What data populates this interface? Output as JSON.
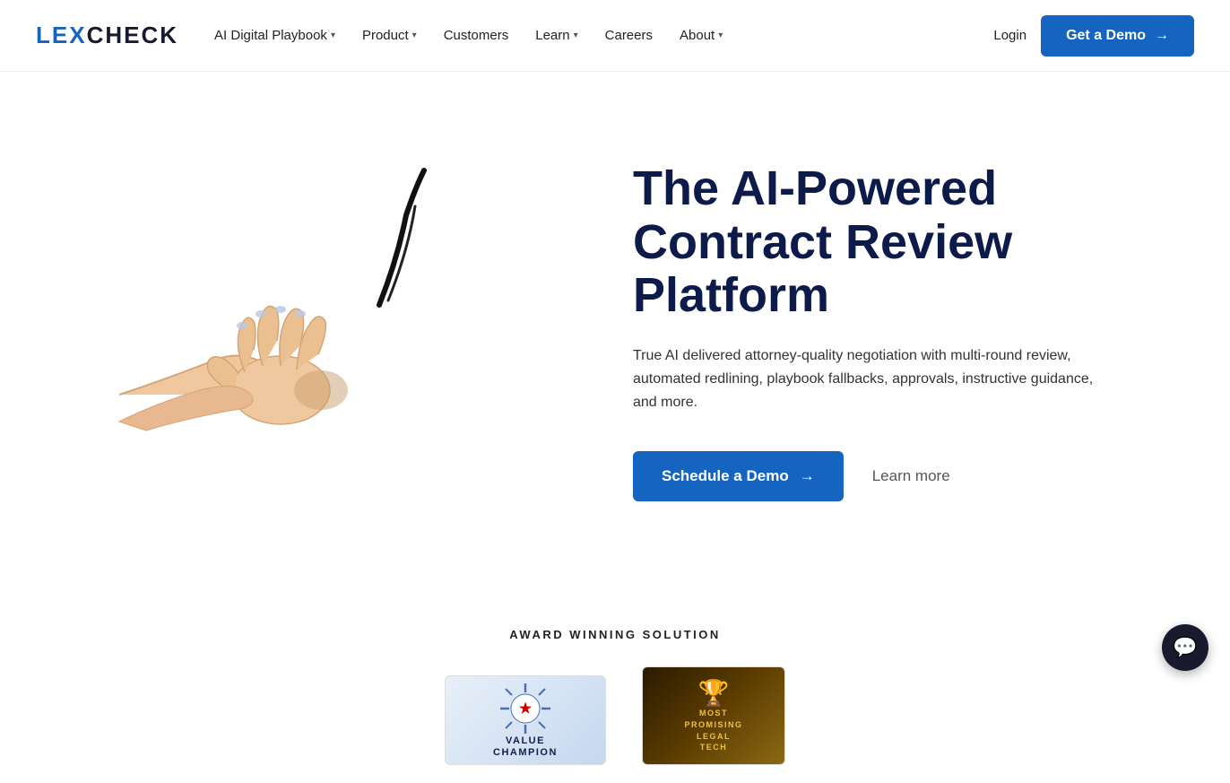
{
  "brand": {
    "name_lex": "LEX",
    "name_check": "CHECK",
    "logo_label": "LexCheck logo"
  },
  "nav": {
    "links": [
      {
        "id": "ai-digital-playbook",
        "label": "AI Digital Playbook",
        "has_dropdown": true
      },
      {
        "id": "product",
        "label": "Product",
        "has_dropdown": true
      },
      {
        "id": "customers",
        "label": "Customers",
        "has_dropdown": false
      },
      {
        "id": "learn",
        "label": "Learn",
        "has_dropdown": true
      },
      {
        "id": "careers",
        "label": "Careers",
        "has_dropdown": false
      },
      {
        "id": "about",
        "label": "About",
        "has_dropdown": true
      }
    ],
    "login_label": "Login",
    "get_demo_label": "Get a Demo",
    "get_demo_arrow": "→"
  },
  "hero": {
    "title": "The AI-Powered Contract Review Platform",
    "subtitle": "True AI delivered attorney-quality negotiation with multi-round review, automated redlining, playbook fallbacks, approvals, instructive guidance, and more.",
    "cta_primary": "Schedule a Demo",
    "cta_primary_arrow": "→",
    "cta_secondary": "Learn more"
  },
  "awards": {
    "section_label": "AWARD WINNING SOLUTION",
    "badges": [
      {
        "id": "value-champion",
        "star": "★",
        "line1": "VALUE",
        "line2": "CHAMPION"
      },
      {
        "id": "legal-tech",
        "line1": "MOST",
        "line2": "PROMISING",
        "line3": "LEGAL",
        "line4": "TECH"
      }
    ]
  },
  "chat": {
    "icon": "💬",
    "label": "Chat support"
  }
}
